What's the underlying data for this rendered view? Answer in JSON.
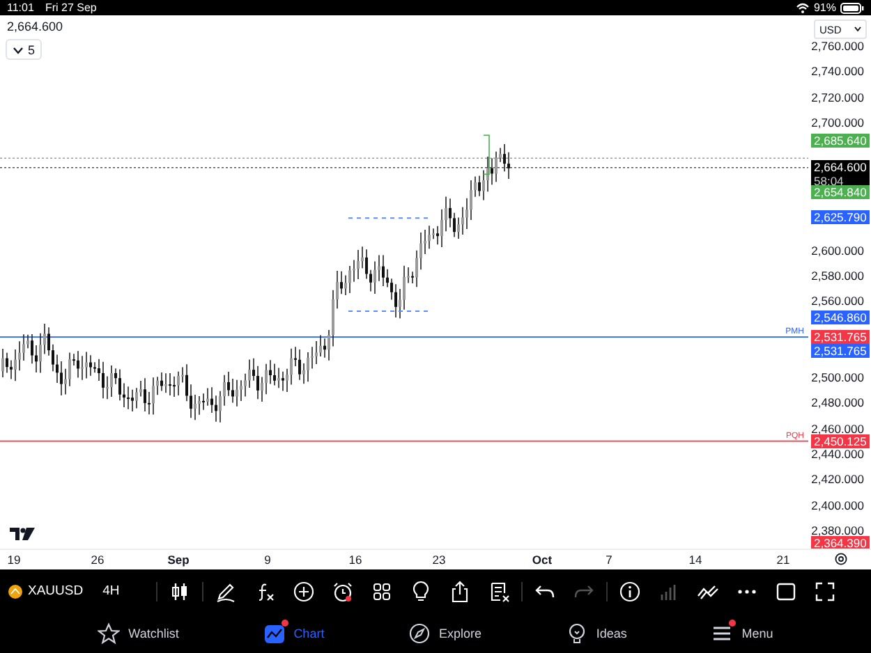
{
  "status_bar": {
    "time": "11:01",
    "date": "Fri 27 Sep",
    "battery": "91%"
  },
  "chart": {
    "price": "2,664.600",
    "collapse": {
      "count": "5",
      "expanded": false
    },
    "currency": "USD",
    "price_axis": [
      "2,760.000",
      "2,740.000",
      "2,720.000",
      "2,700.000",
      "2,600.000",
      "2,580.000",
      "2,560.000",
      "2,500.000",
      "2,480.000",
      "2,460.000",
      "2,440.000",
      "2,420.000",
      "2,400.000",
      "2,380.000"
    ],
    "price_tags": [
      {
        "value": "2,685.640",
        "color": "#4caf50"
      },
      {
        "value": "2,664.600",
        "color": "#000000",
        "countdown": "58:04"
      },
      {
        "value": "2,654.840",
        "color": "#4caf50"
      },
      {
        "value": "2,625.790",
        "color": "#2962ff"
      },
      {
        "value": "2,546.860",
        "color": "#2962ff"
      },
      {
        "value": "2,531.765",
        "color": "#f23645"
      },
      {
        "value": "2,531.765",
        "color": "#2962ff"
      },
      {
        "value": "2,450.125",
        "color": "#f23645"
      },
      {
        "value": "2,364.390",
        "color": "#f23645"
      }
    ],
    "levels": [
      {
        "label": "PMH",
        "color": "#2962ff"
      },
      {
        "label": "PQH",
        "color": "#f23645"
      }
    ],
    "time_axis": [
      {
        "label": "19",
        "kind": "day"
      },
      {
        "label": "26",
        "kind": "day"
      },
      {
        "label": "Sep",
        "kind": "month"
      },
      {
        "label": "9",
        "kind": "day"
      },
      {
        "label": "16",
        "kind": "day"
      },
      {
        "label": "23",
        "kind": "day"
      },
      {
        "label": "Oct",
        "kind": "month"
      },
      {
        "label": "7",
        "kind": "day"
      },
      {
        "label": "14",
        "kind": "day"
      },
      {
        "label": "21",
        "kind": "day"
      }
    ]
  },
  "toolbar": {
    "symbol": "XAUUSD",
    "interval": "4H",
    "buttons": [
      {
        "disabled": false,
        "badge": false
      },
      {
        "disabled": false,
        "badge": false
      },
      {
        "disabled": false,
        "badge": false
      },
      {
        "disabled": false,
        "badge": false
      },
      {
        "disabled": false,
        "badge": true
      },
      {
        "disabled": false,
        "badge": false
      },
      {
        "disabled": false,
        "badge": false
      },
      {
        "disabled": false,
        "badge": false
      },
      {
        "disabled": false,
        "badge": false
      },
      {
        "disabled": false,
        "badge": false
      },
      {
        "disabled": true,
        "badge": false
      },
      {
        "disabled": false,
        "badge": false
      },
      {
        "disabled": true,
        "badge": false
      },
      {
        "disabled": false,
        "badge": false
      },
      {
        "disabled": false,
        "badge": false
      },
      {
        "disabled": false,
        "badge": false
      },
      {
        "disabled": false,
        "badge": false
      }
    ]
  },
  "tabs": [
    {
      "label": "Watchlist",
      "selected": false,
      "badge": false
    },
    {
      "label": "Chart",
      "selected": true,
      "badge": true
    },
    {
      "label": "Explore",
      "selected": false,
      "badge": false
    },
    {
      "label": "Ideas",
      "selected": false,
      "badge": false
    },
    {
      "label": "Menu",
      "selected": false,
      "badge": true
    }
  ]
}
